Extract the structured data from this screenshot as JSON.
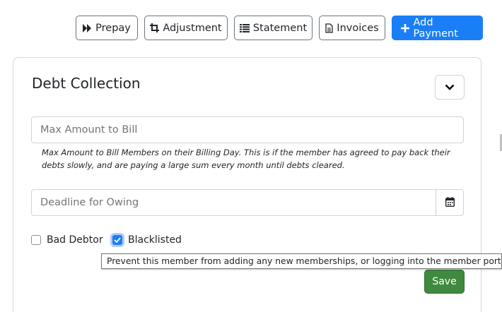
{
  "toolbar": {
    "prepay": {
      "label": "Prepay",
      "icon": "fast-forward-icon"
    },
    "adjustment": {
      "label": "Adjustment",
      "icon": "crop-icon"
    },
    "statement": {
      "label": "Statement",
      "icon": "list-icon"
    },
    "invoices": {
      "label": "Invoices",
      "icon": "document-icon"
    },
    "add_payment": {
      "label": "Add Payment",
      "icon": "plus-icon"
    }
  },
  "debt_collection": {
    "title": "Debt Collection",
    "collapse_icon": "chevron-down-icon",
    "max_amount": {
      "placeholder": "Max Amount to Bill",
      "value": ""
    },
    "max_amount_help": "Max Amount to Bill Members on their Billing Day. This is if the member has agreed to pay back their debts slowly, and are paying a large sum every month until debts cleared.",
    "deadline": {
      "placeholder": "Deadline for Owing",
      "value": ""
    },
    "calendar_icon": "calendar-icon",
    "bad_debtor": {
      "label": "Bad Debtor",
      "checked": false
    },
    "blacklisted": {
      "label": "Blacklisted",
      "checked": true
    },
    "blacklisted_tooltip": "Prevent this member from adding any new memberships, or logging into the member portal",
    "save_label": "Save"
  },
  "colors": {
    "primary": "#1a7ff6",
    "success": "#3f8a3e",
    "border": "#ced4da"
  }
}
